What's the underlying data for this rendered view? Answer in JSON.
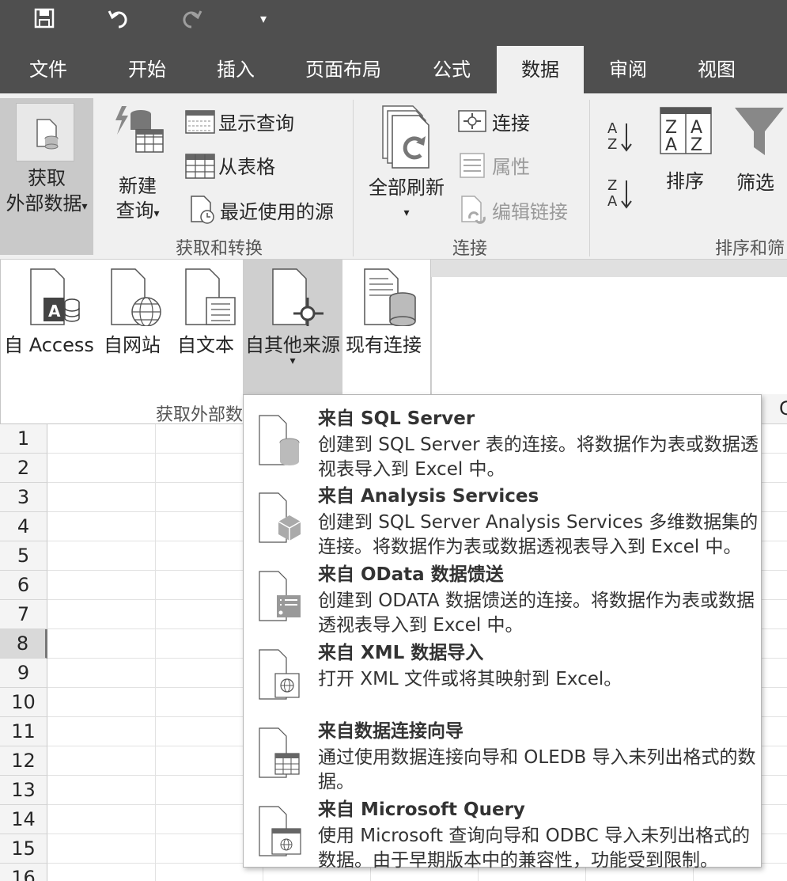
{
  "qat": {
    "save": "save-icon",
    "undo": "undo-icon",
    "redo": "redo-icon",
    "customize": "▾"
  },
  "tabs": [
    {
      "label": "文件"
    },
    {
      "label": "开始"
    },
    {
      "label": "插入"
    },
    {
      "label": "页面布局"
    },
    {
      "label": "公式"
    },
    {
      "label": "数据"
    },
    {
      "label": "审阅"
    },
    {
      "label": "视图"
    }
  ],
  "ribbon": {
    "get_external": {
      "line1": "获取",
      "line2": "外部数据",
      "arrow": "▾"
    },
    "new_query": {
      "line1": "新建",
      "line2": "查询",
      "arrow": "▾"
    },
    "show_queries": "显示查询",
    "from_table": "从表格",
    "recent_sources": "最近使用的源",
    "group_get_transform": "获取和转换",
    "refresh_all": {
      "label": "全部刷新",
      "arrow": "▾"
    },
    "connections": "连接",
    "properties": "属性",
    "edit_links": "编辑链接",
    "group_connections": "连接",
    "sort_label": "排序",
    "filter_label": "筛选",
    "group_sort_filter": "排序和筛"
  },
  "external_panel": {
    "items": [
      {
        "label": "自 Access"
      },
      {
        "label": "自网站"
      },
      {
        "label": "自文本"
      },
      {
        "label": "自其他来源",
        "arrow": "▾"
      },
      {
        "label": "现有连接"
      }
    ],
    "group_label": "获取外部数"
  },
  "grid": {
    "rows": [
      "1",
      "2",
      "3",
      "4",
      "5",
      "6",
      "7",
      "8",
      "9",
      "10",
      "11",
      "12",
      "13",
      "14",
      "15",
      "16"
    ],
    "selected_row": "8",
    "visible_col_letter_fragment": "C"
  },
  "flyout": {
    "items": [
      {
        "title": "来自 SQL Server",
        "desc": "创建到 SQL Server 表的连接。将数据作为表或数据透视表导入到 Excel 中。"
      },
      {
        "title": "来自 Analysis Services",
        "desc": "创建到 SQL Server Analysis Services 多维数据集的连接。将数据作为表或数据透视表导入到 Excel 中。"
      },
      {
        "title": "来自 OData 数据馈送",
        "desc": "创建到 ODATA 数据馈送的连接。将数据作为表或数据透视表导入到 Excel 中。"
      },
      {
        "title": "来自 XML 数据导入",
        "desc": "打开 XML 文件或将其映射到 Excel。"
      },
      {
        "title": "来自数据连接向导",
        "desc": "通过使用数据连接向导和 OLEDB 导入未列出格式的数据。"
      },
      {
        "title": "来自 Microsoft Query",
        "desc": "使用 Microsoft 查询向导和 ODBC 导入未列出格式的数据。由于早期版本中的兼容性，功能受到限制。"
      }
    ]
  }
}
